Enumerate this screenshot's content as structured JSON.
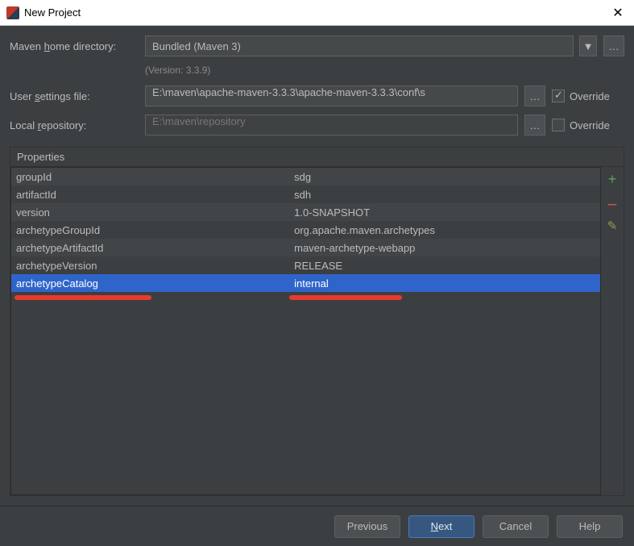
{
  "window": {
    "title": "New Project"
  },
  "form": {
    "mavenHomeLabel_pre": "Maven ",
    "mavenHomeLabel_u": "h",
    "mavenHomeLabel_post": "ome directory:",
    "mavenHomeValue": "Bundled (Maven 3)",
    "versionText": "(Version: 3.3.9)",
    "userSettingsLabel_pre": "User ",
    "userSettingsLabel_u": "s",
    "userSettingsLabel_post": "ettings file:",
    "userSettingsValue": "E:\\maven\\apache-maven-3.3.3\\apache-maven-3.3.3\\conf\\s",
    "localRepoLabel_pre": "Local ",
    "localRepoLabel_u": "r",
    "localRepoLabel_post": "epository:",
    "localRepoValue": "E:\\maven\\repository",
    "overrideLabel": "Override"
  },
  "properties": {
    "title": "Properties",
    "rows": [
      {
        "key": "groupId",
        "val": "sdg"
      },
      {
        "key": "artifactId",
        "val": "sdh"
      },
      {
        "key": "version",
        "val": "1.0-SNAPSHOT"
      },
      {
        "key": "archetypeGroupId",
        "val": "org.apache.maven.archetypes"
      },
      {
        "key": "archetypeArtifactId",
        "val": "maven-archetype-webapp"
      },
      {
        "key": "archetypeVersion",
        "val": "RELEASE"
      },
      {
        "key": "archetypeCatalog",
        "val": "internal"
      }
    ],
    "selectedIndex": 6
  },
  "buttons": {
    "previous": "Previous",
    "next_u": "N",
    "next_post": "ext",
    "cancel": "Cancel",
    "help": "Help"
  }
}
